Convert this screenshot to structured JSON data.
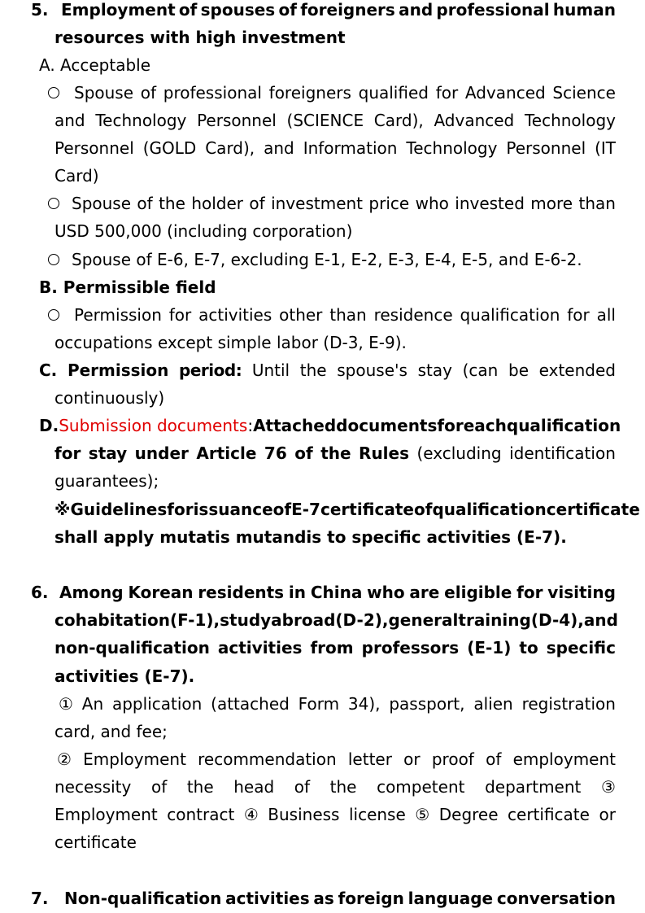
{
  "s5": {
    "num": "5.",
    "title_l1": [
      "Employment",
      "of",
      "spouses",
      "of",
      "foreigners",
      "and",
      "professional",
      "human"
    ],
    "title_l2": "resources with high investment",
    "A": {
      "label": "A. Acceptable",
      "items": [
        {
          "lines": [
            [
              "Spouse",
              "of",
              "professional",
              "foreigners",
              "qualified",
              "for",
              "Advanced",
              "Science"
            ],
            [
              "and",
              "Technology",
              "Personnel",
              "(SCIENCE",
              "Card),",
              "Advanced",
              "Technology"
            ],
            [
              "Personnel",
              "(GOLD",
              "Card),",
              "and",
              "Information",
              "Technology",
              "Personnel",
              "(IT"
            ],
            "Card)"
          ]
        },
        {
          "lines": [
            [
              "Spouse",
              "of",
              "the",
              "holder",
              "of",
              "investment",
              "price",
              "who",
              "invested",
              "more",
              "than"
            ],
            "USD 500,000 (including corporation)"
          ]
        },
        {
          "lines": [
            "Spouse of E-6, E-7, excluding E-1, E-2, E-3, E-4, E-5, and E-6-2."
          ]
        }
      ]
    },
    "B": {
      "label": "B. Permissible field",
      "items": [
        {
          "lines": [
            [
              "Permission",
              "for",
              "activities",
              "other",
              "than",
              "residence",
              "qualification",
              "for",
              "all"
            ],
            "occupations except simple labor (D-3, E-9)."
          ]
        }
      ]
    },
    "C": {
      "prefix": "C.",
      "head": "Permission",
      "head2": "period:",
      "rest": [
        "Until",
        "the",
        "spouse's",
        "stay",
        "(can",
        "be",
        "extended"
      ],
      "line2": "continuously)"
    },
    "D": {
      "prefix": "D.",
      "red": "Submission documents",
      "colon": ":",
      "l1": [
        "Attached",
        "documents",
        "for",
        "each",
        "qualification"
      ],
      "l2_bold": [
        "for",
        "stay",
        "under",
        "Article",
        "76",
        "of",
        "the",
        "Rules"
      ],
      "l2_plain": [
        "(excluding",
        "identification"
      ],
      "l3": "guarantees);",
      "note_l1": [
        "※",
        "Guidelines",
        "for",
        "issuance",
        "of",
        "E-7",
        "certificate",
        "of",
        "qualification",
        "certificate"
      ],
      "note_l2": "shall apply mutatis mutandis to specific activities (E-7)."
    }
  },
  "s6": {
    "num": "6.",
    "l1": [
      "Among",
      "Korean",
      "residents",
      "in",
      "China",
      "who",
      "are",
      "eligible",
      "for",
      "visiting"
    ],
    "l2": [
      "cohabitation",
      "(F-1),",
      "study",
      "abroad",
      "(D-2),",
      "general",
      "training",
      "(D-4),",
      "and"
    ],
    "l3": [
      "non-qualification",
      "activities",
      "from",
      "professors",
      "(E-1)",
      "to",
      "specific"
    ],
    "l4": "activities (E-7).",
    "docs": {
      "l1": [
        "①",
        "An",
        "application",
        "(attached",
        "Form",
        "34),",
        "passport,",
        "alien",
        "registration"
      ],
      "l2": "card, and fee;",
      "l3": [
        "②",
        "Employment",
        "recommendation",
        "letter",
        "or",
        "proof",
        "of",
        "employment"
      ],
      "l4": [
        "necessity",
        "of",
        "the",
        "head",
        "of",
        "the",
        "competent",
        "department",
        "③"
      ],
      "l5": [
        "Employment",
        "contract",
        "④",
        "Business",
        "license",
        "⑤",
        "Degree",
        "certificate",
        "or"
      ],
      "l6": "certificate"
    }
  },
  "s7": {
    "num": "7.",
    "l1": [
      "Non-qualification",
      "activities",
      "as",
      "foreign",
      "language",
      "conversation"
    ]
  }
}
